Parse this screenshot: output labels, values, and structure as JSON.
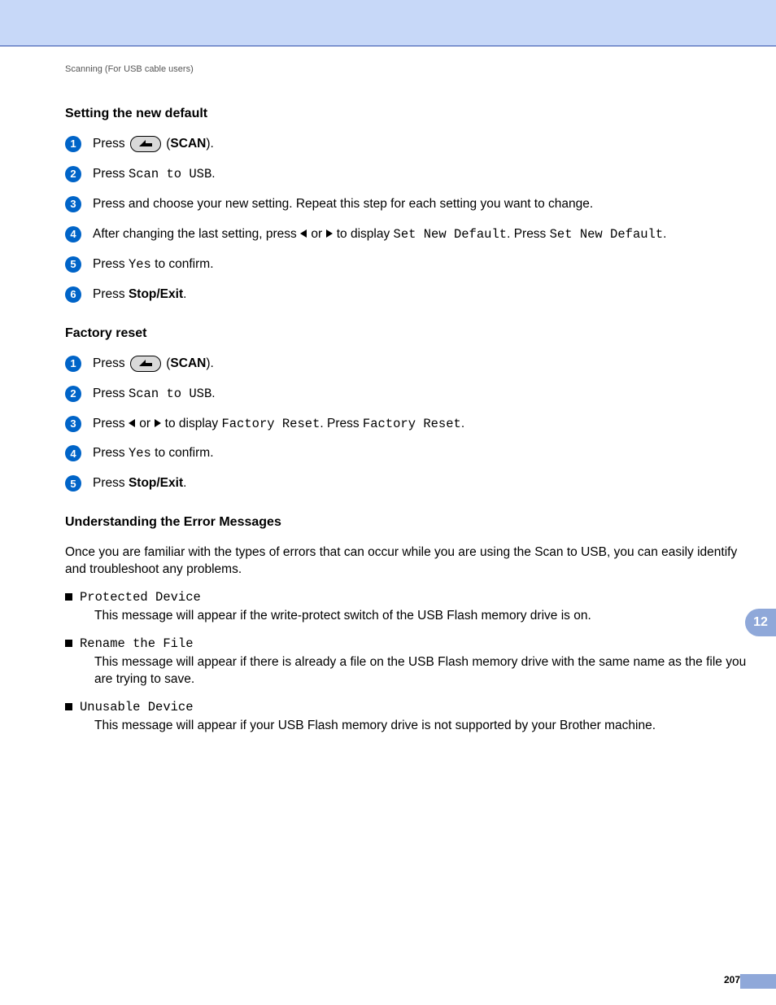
{
  "running_head": "Scanning (For USB cable users)",
  "section1": {
    "title": "Setting the new default",
    "steps": [
      {
        "pre": "Press ",
        "scan_btn": true,
        "post_open": " (",
        "scan_label": "SCAN",
        "post_close": ")."
      },
      {
        "pre": "Press ",
        "mono": "Scan to USB",
        "post": "."
      },
      {
        "text": "Press and choose your new setting. Repeat this step for each setting you want to change."
      },
      {
        "pre": "After changing the last setting, press ",
        "tri_left": true,
        "mid1": " or ",
        "tri_right": true,
        "mid2": " to display ",
        "mono1": "Set New Default",
        "mid3": ". Press ",
        "mono2": "Set New Default",
        "post": "."
      },
      {
        "pre": "Press ",
        "mono": "Yes",
        "post": " to confirm."
      },
      {
        "pre": "Press ",
        "bold": "Stop/Exit",
        "post": "."
      }
    ]
  },
  "section2": {
    "title": "Factory reset",
    "steps": [
      {
        "pre": "Press ",
        "scan_btn": true,
        "post_open": " (",
        "scan_label": "SCAN",
        "post_close": ")."
      },
      {
        "pre": "Press ",
        "mono": "Scan to USB",
        "post": "."
      },
      {
        "pre": "Press ",
        "tri_left": true,
        "mid1": " or ",
        "tri_right": true,
        "mid2": " to display ",
        "mono1": "Factory Reset",
        "mid3": ". Press ",
        "mono2": "Factory Reset",
        "post": "."
      },
      {
        "pre": "Press ",
        "mono": "Yes",
        "post": " to confirm."
      },
      {
        "pre": "Press ",
        "bold": "Stop/Exit",
        "post": "."
      }
    ]
  },
  "section3": {
    "title": "Understanding the Error Messages",
    "intro": "Once you are familiar with the types of errors that can occur while you are using the Scan to USB, you can easily identify and troubleshoot any problems.",
    "errors": [
      {
        "name": "Protected Device",
        "desc": "This message will appear if the write-protect switch of the USB Flash memory drive is on."
      },
      {
        "name": "Rename the File",
        "desc": "This message will appear if there is already a file on the USB Flash memory drive with the same name as the file you are trying to save."
      },
      {
        "name": "Unusable Device",
        "desc": "This message will appear if your USB Flash memory drive is not supported by your Brother machine."
      }
    ]
  },
  "chapter_tab": "12",
  "page_number": "207"
}
